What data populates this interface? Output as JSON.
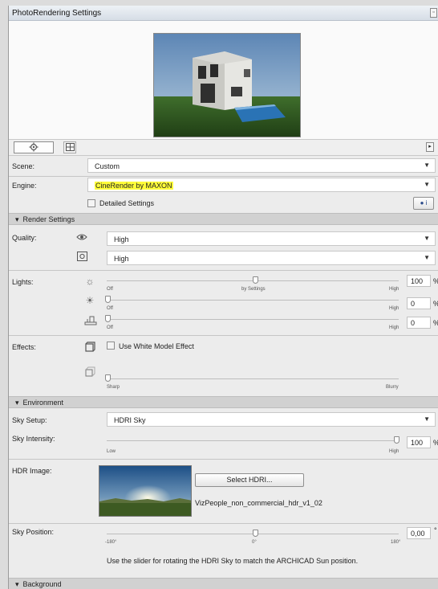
{
  "window": {
    "title": "PhotoRendering Settings"
  },
  "scene": {
    "label": "Scene:",
    "value": "Custom"
  },
  "engine": {
    "label": "Engine:",
    "value": "CineRender by MAXON"
  },
  "detailed_settings": {
    "label": "Detailed Settings",
    "checked": false
  },
  "render_settings": {
    "header": "Render Settings",
    "quality_label": "Quality:",
    "quality_1": "High",
    "quality_2": "High",
    "lights_label": "Lights:",
    "light_1": {
      "value": "100",
      "unit": "%",
      "min": "Off",
      "mid": "by Settings",
      "max": "High"
    },
    "light_2": {
      "value": "0",
      "unit": "%",
      "min": "Off",
      "max": "High"
    },
    "light_3": {
      "value": "0",
      "unit": "%",
      "min": "Off",
      "max": "High"
    },
    "effects_label": "Effects:",
    "white_model": {
      "label": "Use White Model Effect",
      "checked": false
    },
    "blur": {
      "min": "Sharp",
      "max": "Blurry"
    }
  },
  "environment": {
    "header": "Environment",
    "sky_setup_label": "Sky Setup:",
    "sky_setup_value": "HDRI Sky",
    "sky_intensity_label": "Sky Intensity:",
    "sky_intensity": {
      "value": "100",
      "unit": "%",
      "min": "Low",
      "max": "High"
    },
    "hdr_image_label": "HDR Image:",
    "select_hdri_button": "Select HDRI...",
    "hdri_filename": "VizPeople_non_commercial_hdr_v1_02",
    "sky_position_label": "Sky Position:",
    "sky_position": {
      "value": "0,00",
      "unit": "°",
      "min": "-180°",
      "mid": "0°",
      "max": "180°"
    },
    "hint": "Use the slider for rotating the HDRI Sky to match the ARCHICAD Sun position."
  },
  "background": {
    "header": "Background"
  },
  "colors": {
    "highlight": "#fffd3a",
    "section_bg": "#d1d1d1",
    "panel_bg": "#ececec"
  }
}
